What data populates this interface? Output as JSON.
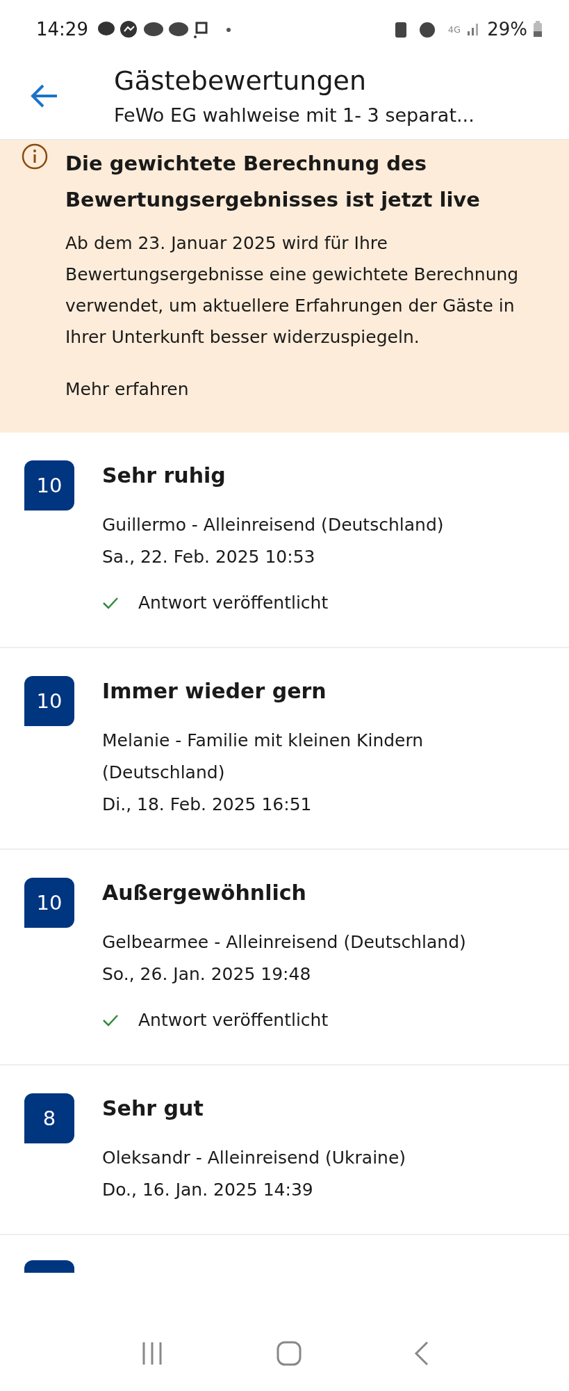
{
  "status_bar": {
    "time": "14:29",
    "battery": "29%",
    "network": "4G"
  },
  "header": {
    "title": "Gästebewertungen",
    "subtitle": "FeWo EG wahlweise mit 1- 3 separat..."
  },
  "banner": {
    "heading": "Die gewichtete Berechnung des Bewertungsergebnisses ist jetzt live",
    "body": "Ab dem 23. Januar 2025 wird für Ihre Bewertungsergebnisse eine gewichtete Berechnung verwendet, um aktuellere Erfahrungen der Gäste in Ihrer Unterkunft besser widerzuspiegeln.",
    "link": "Mehr erfahren"
  },
  "reviews": [
    {
      "score": "10",
      "title": "Sehr ruhig",
      "guest": "Guillermo - Alleinreisend (Deutschland)",
      "date": "Sa., 22. Feb. 2025 10:53",
      "reply": "Antwort veröffentlicht"
    },
    {
      "score": "10",
      "title": "Immer wieder gern",
      "guest": "Melanie - Familie mit kleinen Kindern (Deutschland)",
      "date": "Di., 18. Feb. 2025 16:51"
    },
    {
      "score": "10",
      "title": "Außergewöhnlich",
      "guest": "Gelbearmee - Alleinreisend (Deutschland)",
      "date": "So., 26. Jan. 2025 19:48",
      "reply": "Antwort veröffentlicht"
    },
    {
      "score": "8",
      "title": "Sehr gut",
      "guest": "Oleksandr - Alleinreisend (Ukraine)",
      "date": "Do., 16. Jan. 2025 14:39"
    }
  ]
}
